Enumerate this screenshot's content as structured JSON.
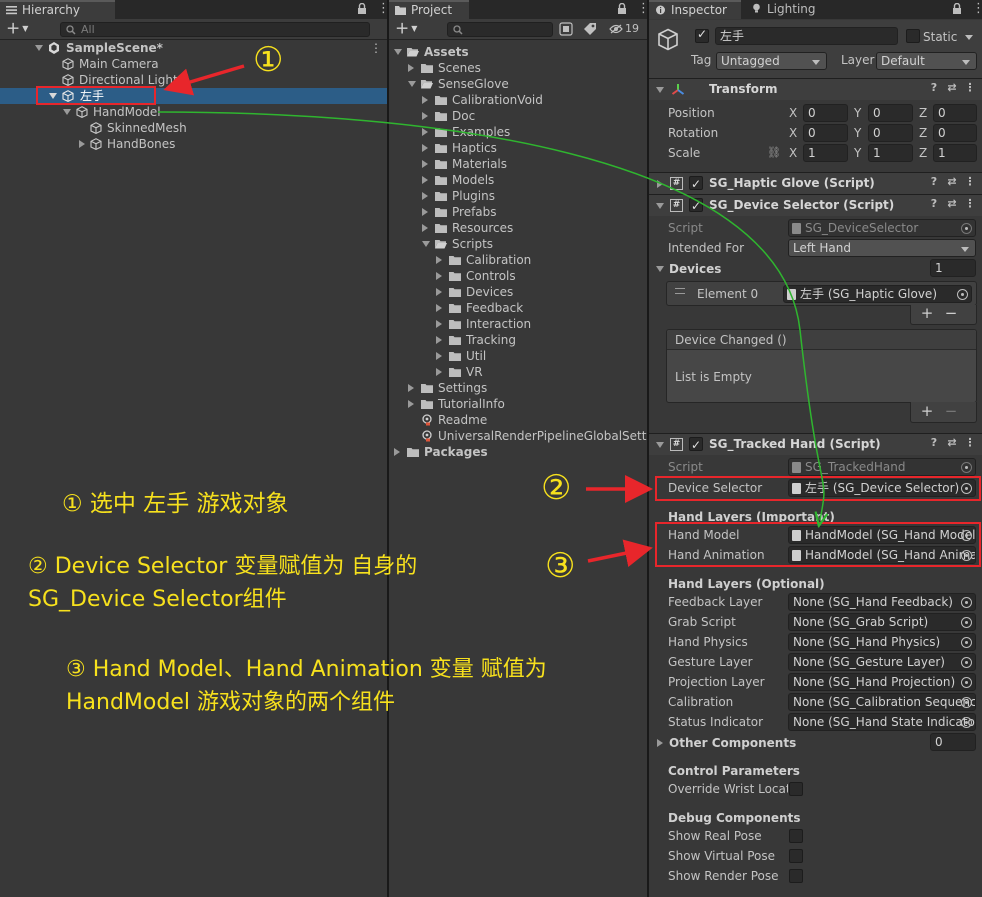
{
  "hierarchy": {
    "tab": "Hierarchy",
    "search_placeholder": "All",
    "items": [
      {
        "label": "SampleScene*"
      },
      {
        "label": "Main Camera"
      },
      {
        "label": "Directional Light"
      },
      {
        "label": "左手"
      },
      {
        "label": "HandModel"
      },
      {
        "label": "SkinnedMesh"
      },
      {
        "label": "HandBones"
      }
    ]
  },
  "project": {
    "tab": "Project",
    "badge_count": "19",
    "items": [
      {
        "label": "Assets"
      },
      {
        "label": "Scenes"
      },
      {
        "label": "SenseGlove"
      },
      {
        "label": "CalibrationVoid"
      },
      {
        "label": "Doc"
      },
      {
        "label": "Examples"
      },
      {
        "label": "Haptics"
      },
      {
        "label": "Materials"
      },
      {
        "label": "Models"
      },
      {
        "label": "Plugins"
      },
      {
        "label": "Prefabs"
      },
      {
        "label": "Resources"
      },
      {
        "label": "Scripts"
      },
      {
        "label": "Calibration"
      },
      {
        "label": "Controls"
      },
      {
        "label": "Devices"
      },
      {
        "label": "Feedback"
      },
      {
        "label": "Interaction"
      },
      {
        "label": "Tracking"
      },
      {
        "label": "Util"
      },
      {
        "label": "VR"
      },
      {
        "label": "Settings"
      },
      {
        "label": "TutorialInfo"
      },
      {
        "label": "Readme"
      },
      {
        "label": "UniversalRenderPipelineGlobalSettings"
      },
      {
        "label": "Packages"
      }
    ]
  },
  "inspector": {
    "tab": "Inspector",
    "tab2": "Lighting",
    "object_name": "左手",
    "static_label": "Static",
    "tag_label": "Tag",
    "tag_value": "Untagged",
    "layer_label": "Layer",
    "layer_value": "Default",
    "transform": {
      "title": "Transform",
      "position_label": "Position",
      "rotation_label": "Rotation",
      "scale_label": "Scale",
      "axis_x": "X",
      "axis_y": "Y",
      "axis_z": "Z",
      "position": [
        "0",
        "0",
        "0"
      ],
      "rotation": [
        "0",
        "0",
        "0"
      ],
      "scale": [
        "1",
        "1",
        "1"
      ]
    },
    "haptic_glove": {
      "title": "SG_Haptic Glove (Script)"
    },
    "device_selector": {
      "title": "SG_Device Selector (Script)",
      "script_label": "Script",
      "script_value": "SG_DeviceSelector",
      "intended_label": "Intended For",
      "intended_value": "Left Hand",
      "devices_label": "Devices",
      "devices_count": "1",
      "element_label": "Element 0",
      "element_value": "左手 (SG_Haptic Glove)",
      "event_label": "Device Changed ()",
      "event_empty": "List is Empty",
      "plus": "+",
      "minus": "−"
    },
    "tracked_hand": {
      "title": "SG_Tracked Hand (Script)",
      "script_label": "Script",
      "script_value": "SG_TrackedHand",
      "device_selector_label": "Device Selector",
      "device_selector_value": "左手 (SG_Device Selector)",
      "hand_layers_important": "Hand Layers (Important)",
      "hand_model_label": "Hand Model",
      "hand_model_value": "HandModel (SG_Hand Model)",
      "hand_anim_label": "Hand Animation",
      "hand_anim_value": "HandModel (SG_Hand Animation)",
      "hand_layers_optional": "Hand Layers (Optional)",
      "optional": [
        {
          "label": "Feedback Layer",
          "value": "None (SG_Hand Feedback)"
        },
        {
          "label": "Grab Script",
          "value": "None (SG_Grab Script)"
        },
        {
          "label": "Hand Physics",
          "value": "None (SG_Hand Physics)"
        },
        {
          "label": "Gesture Layer",
          "value": "None (SG_Gesture Layer)"
        },
        {
          "label": "Projection Layer",
          "value": "None (SG_Hand Projection)"
        },
        {
          "label": "Calibration",
          "value": "None (SG_Calibration Sequence)"
        },
        {
          "label": "Status Indicator",
          "value": "None (SG_Hand State Indicator)"
        }
      ],
      "other_components_label": "Other Components",
      "other_components_count": "0",
      "control_params": "Control Parameters",
      "override_wrist": "Override Wrist Location",
      "debug_components": "Debug Components",
      "show_real": "Show Real Pose",
      "show_virtual": "Show Virtual Pose",
      "show_render": "Show Render Pose"
    }
  },
  "annotations": {
    "circle1": "①",
    "circle2": "②",
    "circle3": "③",
    "note1": "① 选中 左手 游戏对象",
    "note2_line1": "② Device Selector 变量赋值为 自身的",
    "note2_line2": "SG_Device Selector组件",
    "note3_line1": "③ Hand Model、Hand Animation 变量 赋值为",
    "note3_line2": "HandModel 游戏对象的两个组件",
    "color": "#f7e11d",
    "box_color": "#e8262b",
    "arrow_color": "#2fb52f"
  }
}
